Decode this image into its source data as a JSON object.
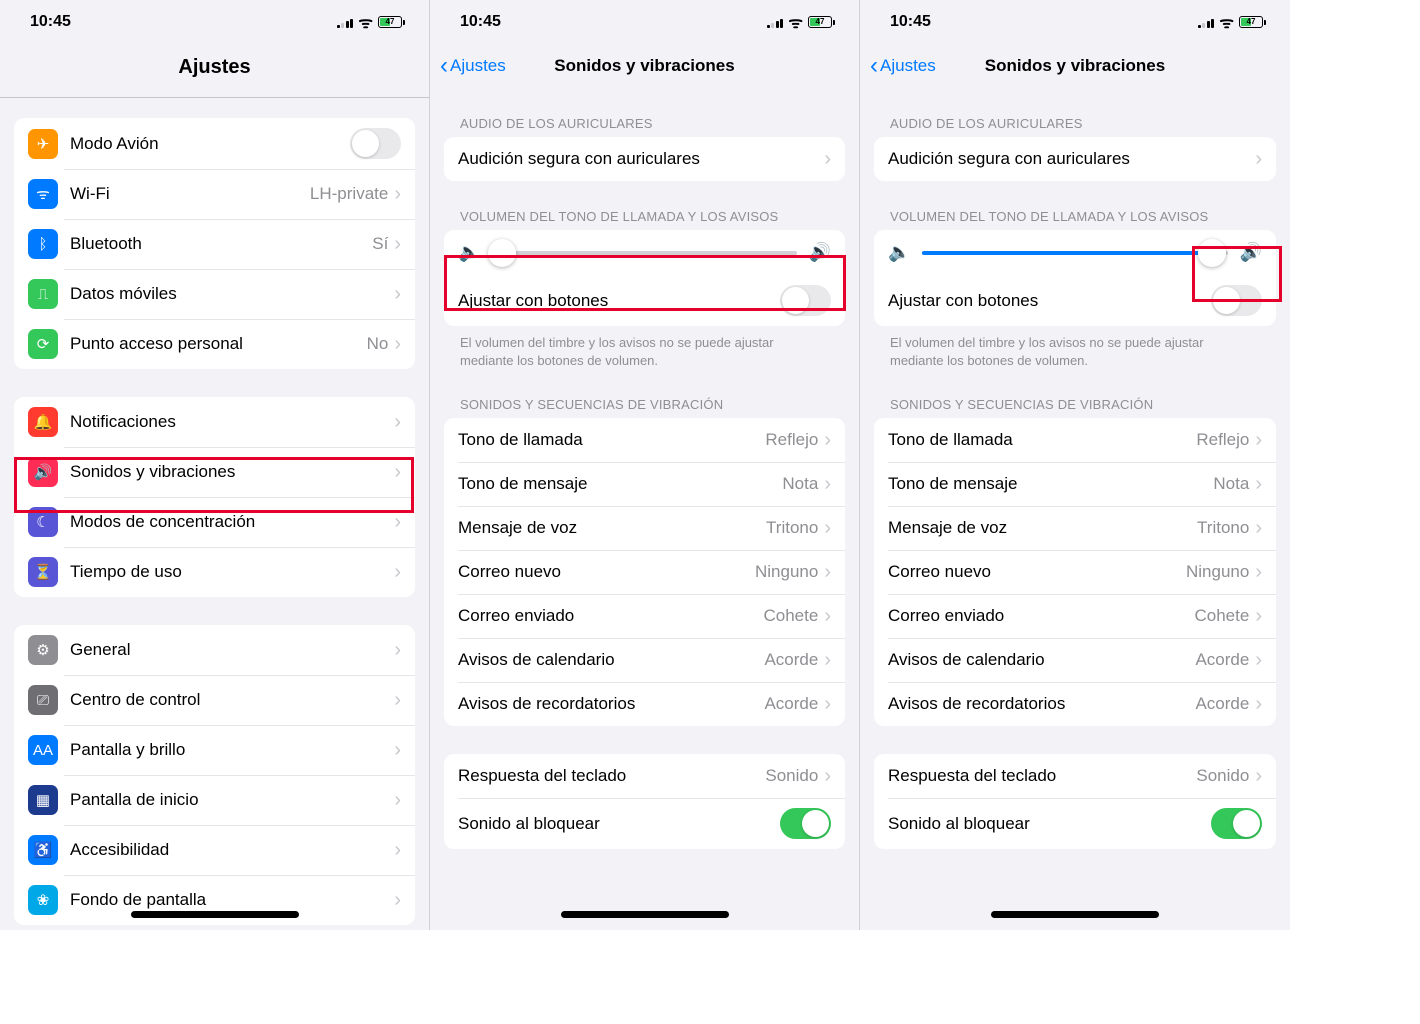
{
  "status": {
    "time": "10:45",
    "battery": "47"
  },
  "screen1": {
    "title": "Ajustes",
    "groups": [
      [
        {
          "icon": "airplane-icon",
          "bg": "bg-orange",
          "glyph": "✈",
          "label": "Modo Avión",
          "type": "toggle",
          "on": false
        },
        {
          "icon": "wifi-icon",
          "bg": "bg-blue",
          "glyph": "ᯤ",
          "label": "Wi-Fi",
          "value": "LH-private"
        },
        {
          "icon": "bluetooth-icon",
          "bg": "bg-bt",
          "glyph": "ᛒ",
          "label": "Bluetooth",
          "value": "Sí"
        },
        {
          "icon": "cellular-icon",
          "bg": "bg-green",
          "glyph": "⎍",
          "label": "Datos móviles"
        },
        {
          "icon": "hotspot-icon",
          "bg": "bg-green",
          "glyph": "⟳",
          "label": "Punto acceso personal",
          "value": "No"
        }
      ],
      [
        {
          "icon": "bell-icon",
          "bg": "bg-red",
          "glyph": "🔔",
          "label": "Notificaciones"
        },
        {
          "icon": "sound-icon",
          "bg": "bg-pink",
          "glyph": "🔊",
          "label": "Sonidos y vibraciones",
          "highlighted": true
        },
        {
          "icon": "focus-icon",
          "bg": "bg-indigo",
          "glyph": "☾",
          "label": "Modos de concentración"
        },
        {
          "icon": "screentime-icon",
          "bg": "bg-indigo",
          "glyph": "⏳",
          "label": "Tiempo de uso"
        }
      ],
      [
        {
          "icon": "gear-icon",
          "bg": "bg-gray",
          "glyph": "⚙",
          "label": "General"
        },
        {
          "icon": "control-icon",
          "bg": "bg-dgray",
          "glyph": "⎚",
          "label": "Centro de control"
        },
        {
          "icon": "display-icon",
          "bg": "bg-blue",
          "glyph": "AA",
          "label": "Pantalla y brillo"
        },
        {
          "icon": "home-icon",
          "bg": "bg-navy",
          "glyph": "▦",
          "label": "Pantalla de inicio"
        },
        {
          "icon": "accessibility-icon",
          "bg": "bg-blue",
          "glyph": "♿",
          "label": "Accesibilidad"
        },
        {
          "icon": "wallpaper-icon",
          "bg": "bg-cyan",
          "glyph": "❀",
          "label": "Fondo de pantalla"
        }
      ]
    ]
  },
  "sounds": {
    "back": "Ajustes",
    "title": "Sonidos y vibraciones",
    "headphone_header": "AUDIO DE LOS AURICULARES",
    "headphone_item": "Audición segura con auriculares",
    "volume_header": "VOLUMEN DEL TONO DE LLAMADA Y LOS AVISOS",
    "buttons_label": "Ajustar con botones",
    "buttons_footer": "El volumen del timbre y los avisos no se puede ajustar mediante los botones de volumen.",
    "tones_header": "SONIDOS Y SECUENCIAS DE VIBRACIÓN",
    "tones": [
      {
        "label": "Tono de llamada",
        "value": "Reflejo"
      },
      {
        "label": "Tono de mensaje",
        "value": "Nota"
      },
      {
        "label": "Mensaje de voz",
        "value": "Tritono"
      },
      {
        "label": "Correo nuevo",
        "value": "Ninguno"
      },
      {
        "label": "Correo enviado",
        "value": "Cohete"
      },
      {
        "label": "Avisos de calendario",
        "value": "Acorde"
      },
      {
        "label": "Avisos de recordatorios",
        "value": "Acorde"
      }
    ],
    "keyboard_label": "Respuesta del teclado",
    "keyboard_value": "Sonido",
    "lock_label": "Sonido al bloquear",
    "slider_low": 3,
    "slider_high": 95
  }
}
